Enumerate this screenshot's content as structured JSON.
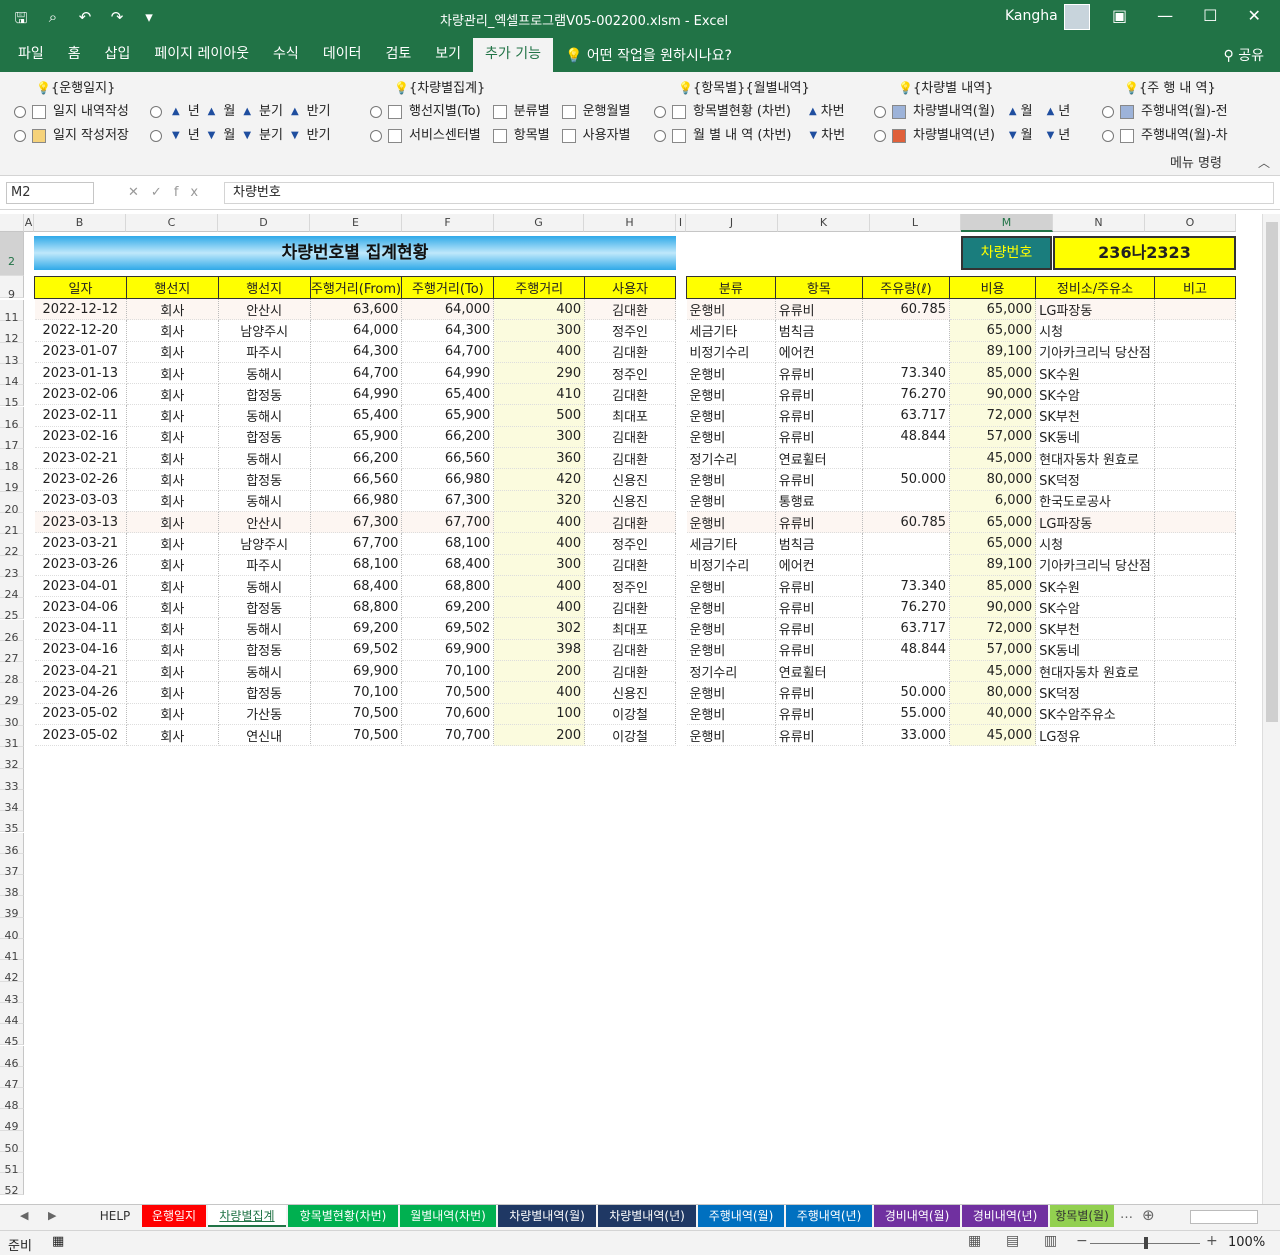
{
  "window": {
    "title": "차량관리_엑셀프로그램V05-002200.xlsm  -  Excel",
    "user": "Kangha"
  },
  "ribbon_tabs": [
    "파일",
    "홈",
    "삽입",
    "페이지 레이아웃",
    "수식",
    "데이터",
    "검토",
    "보기",
    "추가 기능"
  ],
  "active_tab": "추가 기능",
  "tell_me": "어떤 작업을 원하시나요?",
  "share": "공유",
  "ribbon": {
    "g1": {
      "title": "{운행일지}",
      "r1": "일지 내역작성",
      "r2": "일지 작성저장"
    },
    "g2": {
      "year": "년",
      "month": "월",
      "quarter": "분기",
      "half": "반기"
    },
    "g3": {
      "title": "{차량별집계}",
      "a1": "행선지별(To)",
      "a2": "분류별",
      "a3": "운행월별",
      "b1": "서비스센터별",
      "b2": "항목별",
      "b3": "사용자별"
    },
    "g4": {
      "title": "{항목별}{월별내역}",
      "r1": "항목별현황 (차번)",
      "r2": "월 별 내 역 (차번)",
      "car": "차번"
    },
    "g5": {
      "title": "{차량별 내역}",
      "r1": "차량별내역(월)",
      "r2": "차량별내역(년)",
      "m": "월",
      "y": "년"
    },
    "g6": {
      "title": "{주 행 내 역}",
      "r1": "주행내역(월)-전",
      "r2": "주행내역(월)-차"
    },
    "menu_cmd": "메뉴 명령"
  },
  "formula_bar": {
    "name_box": "M2",
    "content": "차량번호"
  },
  "columns": [
    "A",
    "B",
    "C",
    "D",
    "E",
    "F",
    "G",
    "H",
    "I",
    "J",
    "K",
    "L",
    "M",
    "N",
    "O"
  ],
  "rows": [
    "2",
    "9",
    "11",
    "12",
    "13",
    "14",
    "15",
    "16",
    "17",
    "18",
    "19",
    "20",
    "21",
    "22",
    "23",
    "24",
    "25",
    "26",
    "27",
    "28",
    "29",
    "30",
    "31",
    "32",
    "33",
    "34",
    "35",
    "36",
    "37",
    "38",
    "39",
    "40",
    "41",
    "42",
    "43",
    "44",
    "45",
    "46",
    "47",
    "48",
    "49",
    "50",
    "51",
    "52"
  ],
  "banner": "차량번호별 집계현황",
  "vehicle": {
    "label": "차량번호",
    "value": "236나2323"
  },
  "left_headers": [
    "일자",
    "행선지",
    "행선지",
    "주행거리(From)",
    "주행거리(To)",
    "주행거리",
    "사용자"
  ],
  "right_headers": [
    "분류",
    "항목",
    "주유량(ℓ)",
    "비용",
    "정비소/주유소",
    "비고"
  ],
  "left_rows": [
    [
      "2022-12-12",
      "회사",
      "안산시",
      "63,600",
      "64,000",
      "400",
      "김대환"
    ],
    [
      "2022-12-20",
      "회사",
      "남양주시",
      "64,000",
      "64,300",
      "300",
      "정주인"
    ],
    [
      "2023-01-07",
      "회사",
      "파주시",
      "64,300",
      "64,700",
      "400",
      "김대환"
    ],
    [
      "2023-01-13",
      "회사",
      "동해시",
      "64,700",
      "64,990",
      "290",
      "정주인"
    ],
    [
      "2023-02-06",
      "회사",
      "합정동",
      "64,990",
      "65,400",
      "410",
      "김대환"
    ],
    [
      "2023-02-11",
      "회사",
      "동해시",
      "65,400",
      "65,900",
      "500",
      "최대포"
    ],
    [
      "2023-02-16",
      "회사",
      "합정동",
      "65,900",
      "66,200",
      "300",
      "김대환"
    ],
    [
      "2023-02-21",
      "회사",
      "동해시",
      "66,200",
      "66,560",
      "360",
      "김대환"
    ],
    [
      "2023-02-26",
      "회사",
      "합정동",
      "66,560",
      "66,980",
      "420",
      "신용진"
    ],
    [
      "2023-03-03",
      "회사",
      "동해시",
      "66,980",
      "67,300",
      "320",
      "신용진"
    ],
    [
      "2023-03-13",
      "회사",
      "안산시",
      "67,300",
      "67,700",
      "400",
      "김대환"
    ],
    [
      "2023-03-21",
      "회사",
      "남양주시",
      "67,700",
      "68,100",
      "400",
      "정주인"
    ],
    [
      "2023-03-26",
      "회사",
      "파주시",
      "68,100",
      "68,400",
      "300",
      "김대환"
    ],
    [
      "2023-04-01",
      "회사",
      "동해시",
      "68,400",
      "68,800",
      "400",
      "정주인"
    ],
    [
      "2023-04-06",
      "회사",
      "합정동",
      "68,800",
      "69,200",
      "400",
      "김대환"
    ],
    [
      "2023-04-11",
      "회사",
      "동해시",
      "69,200",
      "69,502",
      "302",
      "최대포"
    ],
    [
      "2023-04-16",
      "회사",
      "합정동",
      "69,502",
      "69,900",
      "398",
      "김대환"
    ],
    [
      "2023-04-21",
      "회사",
      "동해시",
      "69,900",
      "70,100",
      "200",
      "김대환"
    ],
    [
      "2023-04-26",
      "회사",
      "합정동",
      "70,100",
      "70,500",
      "400",
      "신용진"
    ],
    [
      "2023-05-02",
      "회사",
      "가산동",
      "70,500",
      "70,600",
      "100",
      "이강철"
    ],
    [
      "2023-05-02",
      "회사",
      "연신내",
      "70,500",
      "70,700",
      "200",
      "이강철"
    ]
  ],
  "right_rows": [
    [
      "운행비",
      "유류비",
      "60.785",
      "65,000",
      "LG파장동",
      ""
    ],
    [
      "세금기타",
      "범칙금",
      "",
      "65,000",
      "시청",
      ""
    ],
    [
      "비정기수리",
      "에어컨",
      "",
      "89,100",
      "기아카크리닉 당산점",
      ""
    ],
    [
      "운행비",
      "유류비",
      "73.340",
      "85,000",
      "SK수원",
      ""
    ],
    [
      "운행비",
      "유류비",
      "76.270",
      "90,000",
      "SK수암",
      ""
    ],
    [
      "운행비",
      "유류비",
      "63.717",
      "72,000",
      "SK부천",
      ""
    ],
    [
      "운행비",
      "유류비",
      "48.844",
      "57,000",
      "SK동네",
      ""
    ],
    [
      "정기수리",
      "연료휠터",
      "",
      "45,000",
      "현대자동차 원효로",
      ""
    ],
    [
      "운행비",
      "유류비",
      "50.000",
      "80,000",
      "SK덕정",
      ""
    ],
    [
      "운행비",
      "통행료",
      "",
      "6,000",
      "한국도로공사",
      ""
    ],
    [
      "운행비",
      "유류비",
      "60.785",
      "65,000",
      "LG파장동",
      ""
    ],
    [
      "세금기타",
      "범칙금",
      "",
      "65,000",
      "시청",
      ""
    ],
    [
      "비정기수리",
      "에어컨",
      "",
      "89,100",
      "기아카크리닉 당산점",
      ""
    ],
    [
      "운행비",
      "유류비",
      "73.340",
      "85,000",
      "SK수원",
      ""
    ],
    [
      "운행비",
      "유류비",
      "76.270",
      "90,000",
      "SK수암",
      ""
    ],
    [
      "운행비",
      "유류비",
      "63.717",
      "72,000",
      "SK부천",
      ""
    ],
    [
      "운행비",
      "유류비",
      "48.844",
      "57,000",
      "SK동네",
      ""
    ],
    [
      "정기수리",
      "연료휠터",
      "",
      "45,000",
      "현대자동차 원효로",
      ""
    ],
    [
      "운행비",
      "유류비",
      "50.000",
      "80,000",
      "SK덕정",
      ""
    ],
    [
      "운행비",
      "유류비",
      "55.000",
      "40,000",
      "SK수암주유소",
      ""
    ],
    [
      "운행비",
      "유류비",
      "33.000",
      "45,000",
      "LG정유",
      ""
    ]
  ],
  "sheet_tabs": [
    {
      "label": "HELP",
      "color": "#f3f3f3"
    },
    {
      "label": "운행일지",
      "color": "#ff0000"
    },
    {
      "label": "차량별집계",
      "color": "#ffffff"
    },
    {
      "label": "항목별현황(차번)",
      "color": "#00b050"
    },
    {
      "label": "월별내역(차번)",
      "color": "#00b050"
    },
    {
      "label": "차량별내역(월)",
      "color": "#1f3864"
    },
    {
      "label": "차량별내역(년)",
      "color": "#1f3864"
    },
    {
      "label": "주행내역(월)",
      "color": "#0070c0"
    },
    {
      "label": "주행내역(년)",
      "color": "#0070c0"
    },
    {
      "label": "경비내역(월)",
      "color": "#7030a0"
    },
    {
      "label": "경비내역(년)",
      "color": "#7030a0"
    },
    {
      "label": "항목별(월)",
      "color": "#92d050"
    }
  ],
  "status": {
    "ready": "준비",
    "zoom": "100%"
  }
}
